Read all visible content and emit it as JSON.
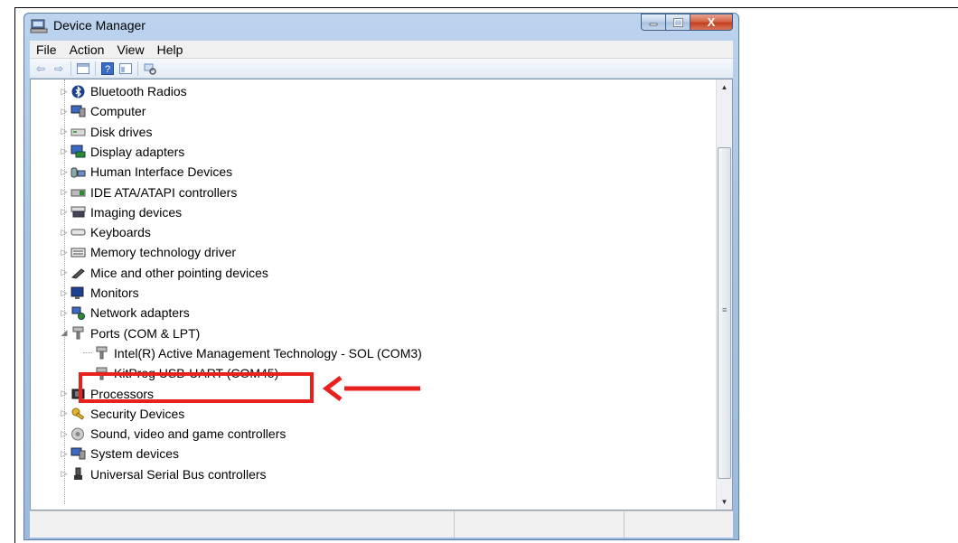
{
  "window": {
    "title": "Device Manager",
    "close_glyph": "X"
  },
  "menu": [
    "File",
    "Action",
    "View",
    "Help"
  ],
  "tree": [
    {
      "label": "Bluetooth Radios",
      "icon": "bluetooth-icon",
      "expander": "▷",
      "level": 1
    },
    {
      "label": "Computer",
      "icon": "computer-icon",
      "expander": "▷",
      "level": 1
    },
    {
      "label": "Disk drives",
      "icon": "disk-drive-icon",
      "expander": "▷",
      "level": 1
    },
    {
      "label": "Display adapters",
      "icon": "display-adapter-icon",
      "expander": "▷",
      "level": 1
    },
    {
      "label": "Human Interface Devices",
      "icon": "hid-icon",
      "expander": "▷",
      "level": 1
    },
    {
      "label": "IDE ATA/ATAPI controllers",
      "icon": "ide-controller-icon",
      "expander": "▷",
      "level": 1
    },
    {
      "label": "Imaging devices",
      "icon": "imaging-device-icon",
      "expander": "▷",
      "level": 1
    },
    {
      "label": "Keyboards",
      "icon": "keyboard-icon",
      "expander": "▷",
      "level": 1
    },
    {
      "label": "Memory technology driver",
      "icon": "memory-icon",
      "expander": "▷",
      "level": 1
    },
    {
      "label": "Mice and other pointing devices",
      "icon": "mouse-icon",
      "expander": "▷",
      "level": 1
    },
    {
      "label": "Monitors",
      "icon": "monitor-icon",
      "expander": "▷",
      "level": 1
    },
    {
      "label": "Network adapters",
      "icon": "network-adapter-icon",
      "expander": "▷",
      "level": 1
    },
    {
      "label": "Ports (COM & LPT)",
      "icon": "port-icon",
      "expander": "◢",
      "level": 1
    },
    {
      "label": "Intel(R) Active Management Technology - SOL (COM3)",
      "icon": "port-icon",
      "expander": "",
      "level": 2
    },
    {
      "label": "KitProg USB-UART (COM45)",
      "icon": "port-icon",
      "expander": "",
      "level": 2
    },
    {
      "label": "Processors",
      "icon": "processor-icon",
      "expander": "▷",
      "level": 1
    },
    {
      "label": "Security Devices",
      "icon": "security-key-icon",
      "expander": "▷",
      "level": 1
    },
    {
      "label": "Sound, video and game controllers",
      "icon": "sound-icon",
      "expander": "▷",
      "level": 1
    },
    {
      "label": "System devices",
      "icon": "system-device-icon",
      "expander": "▷",
      "level": 1
    },
    {
      "label": "Universal Serial Bus controllers",
      "icon": "usb-icon",
      "expander": "▷",
      "level": 1
    }
  ],
  "colors": {
    "highlight": "#e8211f",
    "title_bar": "#a7c3e3"
  }
}
